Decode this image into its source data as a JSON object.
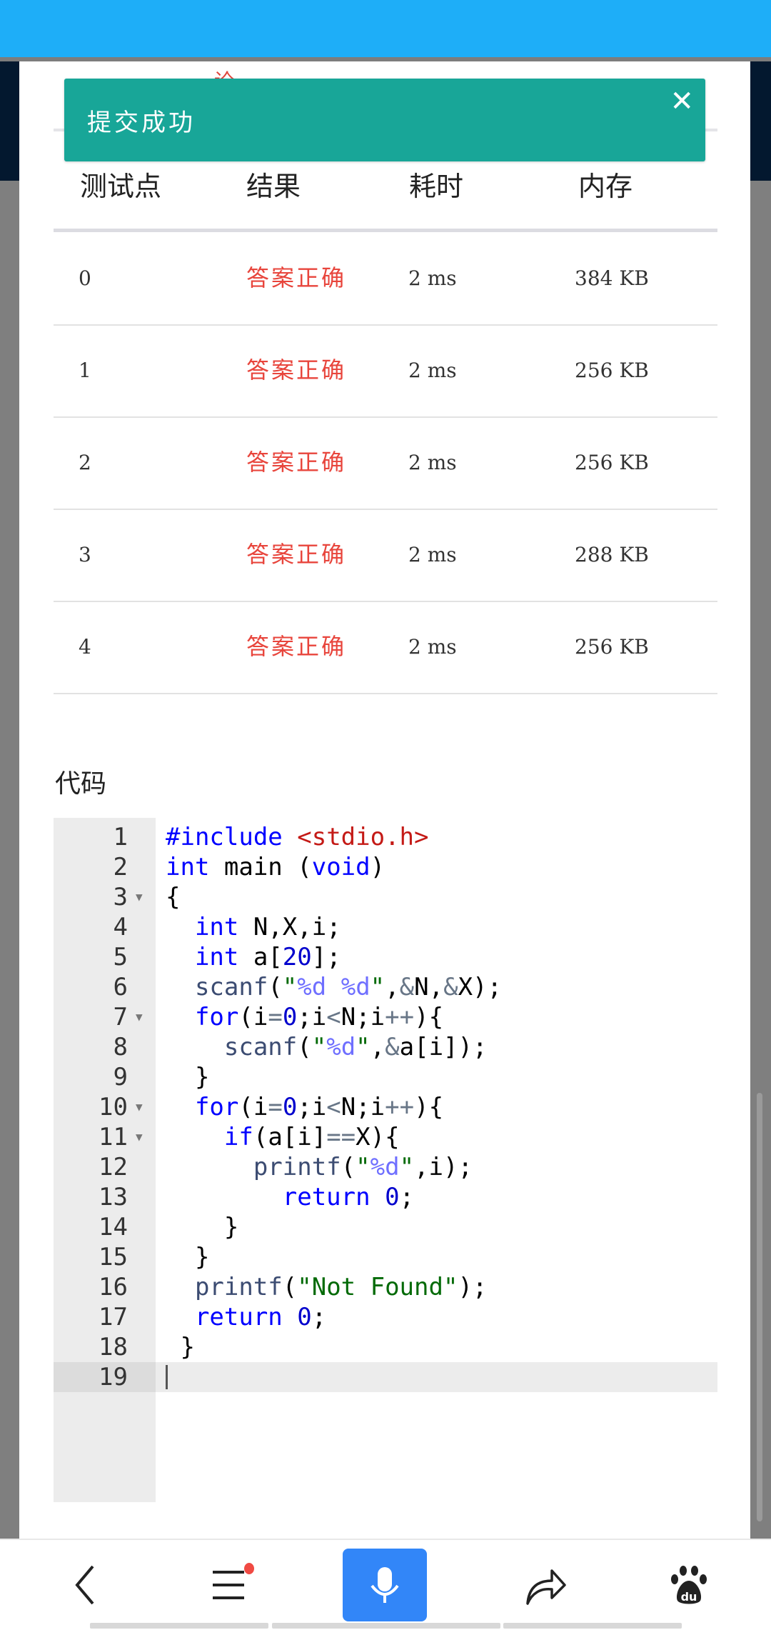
{
  "toast": {
    "message": "提交成功",
    "close_icon": "close-icon",
    "color": "#18a698"
  },
  "obscured_title_fragment": "论",
  "table": {
    "headers": [
      "测试点",
      "结果",
      "耗时",
      "内存"
    ],
    "rows": [
      {
        "id": "0",
        "result": "答案正确",
        "time": "2 ms",
        "memory": "384 KB"
      },
      {
        "id": "1",
        "result": "答案正确",
        "time": "2 ms",
        "memory": "256 KB"
      },
      {
        "id": "2",
        "result": "答案正确",
        "time": "2 ms",
        "memory": "256 KB"
      },
      {
        "id": "3",
        "result": "答案正确",
        "time": "2 ms",
        "memory": "288 KB"
      },
      {
        "id": "4",
        "result": "答案正确",
        "time": "2 ms",
        "memory": "256 KB"
      }
    ]
  },
  "code": {
    "label": "代码",
    "lines": [
      "#include <stdio.h>",
      "int main (void)",
      "{",
      "  int N,X,i;",
      "  int a[20];",
      "  scanf(\"%d %d\",&N,&X);",
      "  for(i=0;i<N;i++){",
      "    scanf(\"%d\",&a[i]);",
      "  }",
      "  for(i=0;i<N;i++){",
      "    if(a[i]==X){",
      "      printf(\"%d\",i);",
      "        return 0;",
      "    }",
      "  }",
      "  printf(\"Not Found\");",
      "  return 0;",
      " }",
      ""
    ],
    "fold_lines": [
      3,
      7,
      10,
      11
    ],
    "active_line": 19
  },
  "bottom_nav": {
    "items": [
      "back-icon",
      "menu-icon",
      "microphone-icon",
      "share-icon",
      "baidu-paw-icon"
    ],
    "menu_has_notification": true,
    "accent": "#3286f8"
  }
}
